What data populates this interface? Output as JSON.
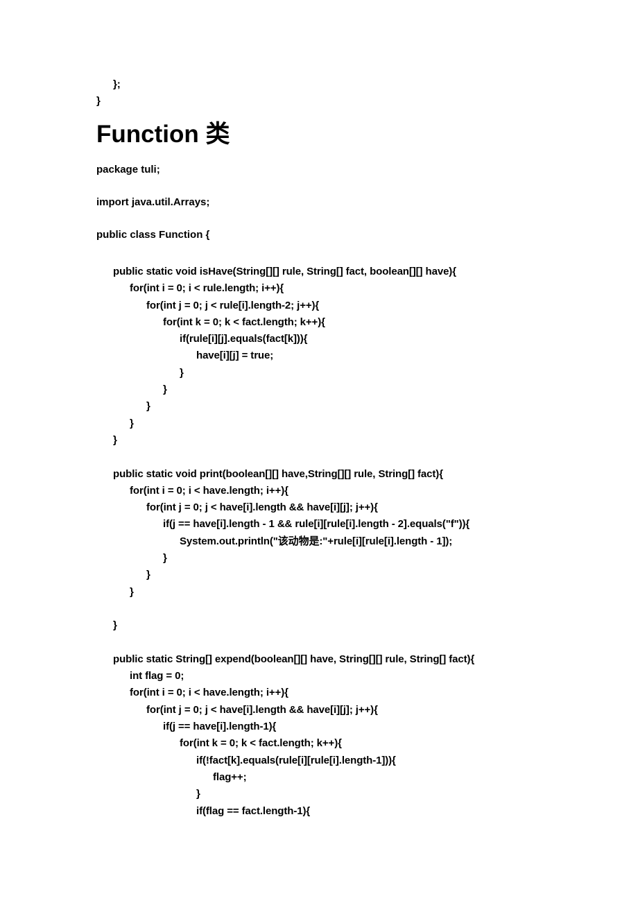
{
  "document": {
    "heading": "Function 类",
    "tail_lines": [
      {
        "indent": 1,
        "text": "};"
      },
      {
        "indent": 0,
        "text": "}"
      }
    ],
    "preamble": [
      {
        "text": "package tuli;"
      },
      {
        "text": "import java.util.Arrays;"
      },
      {
        "text": "public class Function {"
      }
    ],
    "code_lines": [
      {
        "indent": 1,
        "text": "public static void isHave(String[][] rule, String[] fact, boolean[][] have){"
      },
      {
        "indent": 2,
        "text": "for(int i = 0; i < rule.length; i++){"
      },
      {
        "indent": 3,
        "text": "for(int j = 0; j < rule[i].length-2; j++){"
      },
      {
        "indent": 4,
        "text": "for(int k = 0; k < fact.length; k++){"
      },
      {
        "indent": 5,
        "text": "if(rule[i][j].equals(fact[k])){"
      },
      {
        "indent": 6,
        "text": "have[i][j] = true;"
      },
      {
        "indent": 5,
        "text": "}"
      },
      {
        "indent": 4,
        "text": "}"
      },
      {
        "indent": 3,
        "text": "}"
      },
      {
        "indent": 2,
        "text": "}"
      },
      {
        "indent": 1,
        "text": "}"
      },
      {
        "indent": 0,
        "text": ""
      },
      {
        "indent": 1,
        "text": "public static void print(boolean[][] have,String[][] rule, String[] fact){"
      },
      {
        "indent": 2,
        "text": "for(int i = 0; i < have.length; i++){"
      },
      {
        "indent": 3,
        "text": "for(int j = 0; j < have[i].length && have[i][j]; j++){"
      },
      {
        "indent": 4,
        "text": "if(j == have[i].length - 1 && rule[i][rule[i].length - 2].equals(\"f\")){"
      },
      {
        "indent": 5,
        "text": "System.out.println(\"该动物是:\"+rule[i][rule[i].length - 1]);"
      },
      {
        "indent": 4,
        "text": "}"
      },
      {
        "indent": 3,
        "text": "}"
      },
      {
        "indent": 2,
        "text": "}"
      },
      {
        "indent": 0,
        "text": ""
      },
      {
        "indent": 1,
        "text": "}"
      },
      {
        "indent": 0,
        "text": ""
      },
      {
        "indent": 1,
        "text": "public static String[] expend(boolean[][] have, String[][] rule, String[] fact){"
      },
      {
        "indent": 2,
        "text": "int flag = 0;"
      },
      {
        "indent": 2,
        "text": "for(int i = 0; i < have.length; i++){"
      },
      {
        "indent": 3,
        "text": "for(int j = 0; j < have[i].length && have[i][j]; j++){"
      },
      {
        "indent": 4,
        "text": "if(j == have[i].length-1){"
      },
      {
        "indent": 5,
        "text": "for(int k = 0; k < fact.length; k++){"
      },
      {
        "indent": 6,
        "text": "if(!fact[k].equals(rule[i][rule[i].length-1])){"
      },
      {
        "indent": 7,
        "text": "flag++;"
      },
      {
        "indent": 6,
        "text": "}"
      },
      {
        "indent": 6,
        "text": "if(flag == fact.length-1){"
      }
    ]
  },
  "style": {
    "text_color": "#000000",
    "page_background": "#ffffff"
  }
}
